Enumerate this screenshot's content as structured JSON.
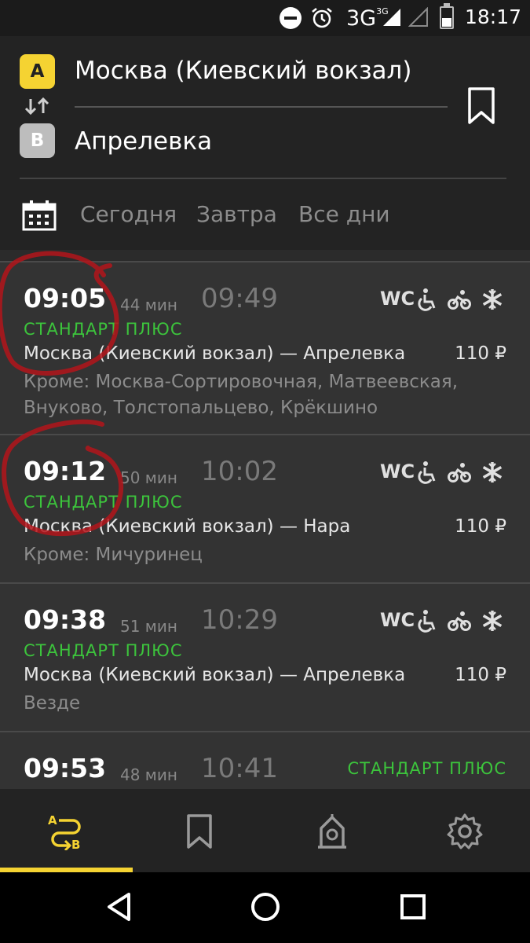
{
  "status_bar": {
    "network": "3G",
    "network_super": "3G",
    "time": "18:17",
    "icons": [
      "do-not-disturb-icon",
      "alarm-icon",
      "signal-icon",
      "battery-icon"
    ]
  },
  "route": {
    "from_badge": "A",
    "from_name": "Москва (Киевский вокзал)",
    "to_badge": "B",
    "to_name": "Апрелевка"
  },
  "day_tabs": [
    "Сегодня",
    "Завтра",
    "Все дни"
  ],
  "trips": [
    {
      "departure": "09:05",
      "duration": "44 мин",
      "arrival": "09:49",
      "train_class": "СТАНДАРТ ПЛЮС",
      "route": "Москва (Киевский вокзал) — Апрелевка",
      "price": "110 ₽",
      "stops": "Кроме: Москва-Сортировочная, Матвеевская, Внуково, Толстопальцево, Крёкшино",
      "amenities": {
        "wc": "WC",
        "icons": [
          "wheelchair-icon",
          "bicycle-icon",
          "snowflake-icon"
        ]
      }
    },
    {
      "departure": "09:12",
      "duration": "50 мин",
      "arrival": "10:02",
      "train_class": "СТАНДАРТ ПЛЮС",
      "route": "Москва (Киевский вокзал) — Нара",
      "price": "110 ₽",
      "stops": "Кроме: Мичуринец",
      "amenities": {
        "wc": "WC",
        "icons": [
          "wheelchair-icon",
          "bicycle-icon",
          "snowflake-icon"
        ]
      }
    },
    {
      "departure": "09:38",
      "duration": "51 мин",
      "arrival": "10:29",
      "train_class": "СТАНДАРТ ПЛЮС",
      "route": "Москва (Киевский вокзал) — Апрелевка",
      "price": "110 ₽",
      "stops": "Везде",
      "amenities": {
        "wc": "WC",
        "icons": [
          "wheelchair-icon",
          "bicycle-icon",
          "snowflake-icon"
        ]
      }
    },
    {
      "departure": "09:53",
      "duration": "48 мин",
      "arrival": "10:41",
      "train_class": "СТАНДАРТ ПЛЮС"
    }
  ],
  "bottom_nav": {
    "tabs": [
      "route-search-icon",
      "bookmark-icon",
      "station-icon",
      "gear-icon"
    ],
    "active_tab": 0
  },
  "colors": {
    "accent": "#f5d332",
    "train_class": "#3cc43c",
    "annotation": "#b3151b"
  }
}
